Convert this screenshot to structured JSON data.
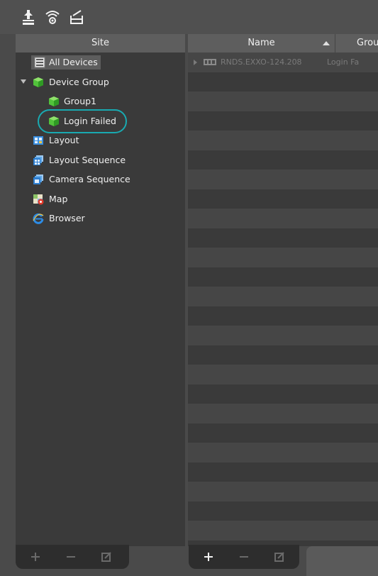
{
  "toolbar": {
    "icons": [
      "upload-icon",
      "wireless-icon",
      "folder-icon"
    ]
  },
  "site_panel": {
    "header": "Site",
    "items": [
      {
        "label": "All Devices",
        "icon": "all-devices-icon",
        "selected": true
      },
      {
        "label": "Device Group",
        "icon": "device-group-icon",
        "expanded": true
      },
      {
        "label": "Group1",
        "icon": "group-icon"
      },
      {
        "label": "Login Failed",
        "icon": "group-icon",
        "highlighted": true
      },
      {
        "label": "Layout",
        "icon": "layout-icon"
      },
      {
        "label": "Layout Sequence",
        "icon": "layout-sequence-icon"
      },
      {
        "label": "Camera Sequence",
        "icon": "camera-sequence-icon"
      },
      {
        "label": "Map",
        "icon": "map-icon"
      },
      {
        "label": "Browser",
        "icon": "browser-icon"
      }
    ],
    "highlight_color": "#19aab1"
  },
  "device_list": {
    "columns": {
      "name": "Name",
      "group": "Grou"
    },
    "sort": "ascending",
    "rows": [
      {
        "name": "RNDS.EXXO-124.208",
        "group": "Login Fa"
      }
    ]
  },
  "bottom_bars": {
    "left_buttons": [
      "add",
      "remove",
      "edit"
    ],
    "right_buttons": [
      "add",
      "remove",
      "edit"
    ]
  }
}
